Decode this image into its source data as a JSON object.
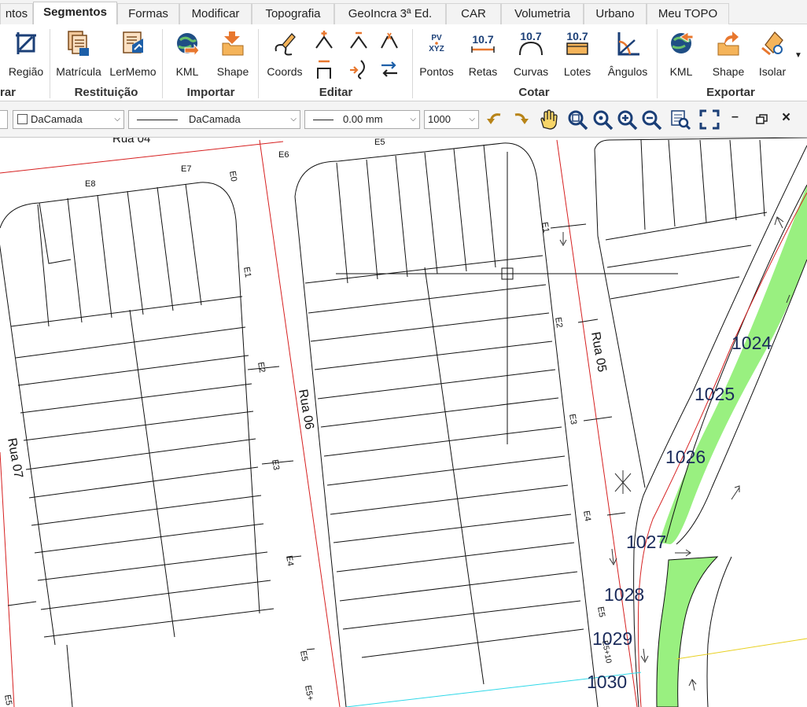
{
  "tabs": [
    {
      "label": "ntos"
    },
    {
      "label": "Segmentos"
    },
    {
      "label": "Formas"
    },
    {
      "label": "Modificar"
    },
    {
      "label": "Topografia"
    },
    {
      "label": "GeoIncra 3ª Ed."
    },
    {
      "label": "CAR"
    },
    {
      "label": "Volumetria"
    },
    {
      "label": "Urbano"
    },
    {
      "label": "Meu TOPO"
    }
  ],
  "ribbon": {
    "buttons": {
      "regiao": "Região",
      "matricula": "Matrícula",
      "lermemo": "LerMemo",
      "kml_import": "KML",
      "shape_import": "Shape",
      "coords": "Coords",
      "pontos": "Pontos",
      "retas": "Retas",
      "curvas": "Curvas",
      "lotes": "Lotes",
      "angulos": "Ângulos",
      "kml_export": "KML",
      "shape_export": "Shape",
      "isolar": "Isolar"
    },
    "groups": {
      "first": "rar",
      "restituicao": "Restituição",
      "importar": "Importar",
      "editar": "Editar",
      "cotar": "Cotar",
      "exportar": "Exportar"
    },
    "icon_texts": {
      "pv": "PV",
      "xyz": "XYZ",
      "ten7": "10.7"
    }
  },
  "toolbar": {
    "color_combo": "DaCamada",
    "linetype_combo": "DaCamada",
    "lineweight_combo": "0.00 mm",
    "scale_combo": "1000",
    "win_minimize": "–",
    "win_close": "×"
  },
  "drawing": {
    "streets": {
      "rua04": "Rua 04",
      "rua05": "Rua 05",
      "rua06": "Rua 06",
      "rua07": "Rua 07"
    },
    "stations": {
      "e0": "E0",
      "e1": "E1",
      "e2": "E2",
      "e3": "E3",
      "e4": "E4",
      "e5": "E5",
      "e6": "E6",
      "e7": "E7",
      "e8": "E8",
      "e5plus": "E5+",
      "e5plus10": "E5+10"
    },
    "points": [
      "1024",
      "1025",
      "1026",
      "1027",
      "1028",
      "1029",
      "1030"
    ]
  },
  "colors": {
    "green_median": "#99f080",
    "street_red": "#d62020",
    "cyan_line": "#2fd8e8",
    "yellow_line": "#e8d020",
    "accent_blue": "#1d5fa8",
    "icon_orange": "#e8772e"
  }
}
